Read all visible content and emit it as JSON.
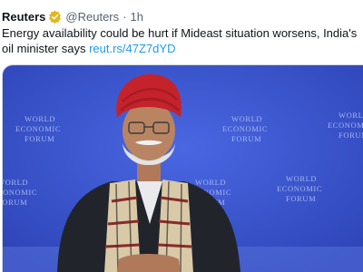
{
  "tweet": {
    "author": "Reuters",
    "handle": "@Reuters",
    "separator": "·",
    "time": "1h",
    "text": "Energy availability could be hurt if Mideast situation worsens, India's oil minister says",
    "link": "reut.rs/47Z7dYD"
  },
  "media": {
    "backdrop_words": [
      "WORLD",
      "ECONOMIC",
      "FORUM"
    ],
    "colors": {
      "backdrop": "#3a55d0",
      "turban": "#c4232b",
      "suit": "#22242b"
    }
  },
  "colors": {
    "link": "#1d9bf0",
    "verified": "#e2b719",
    "muted": "#536471"
  }
}
